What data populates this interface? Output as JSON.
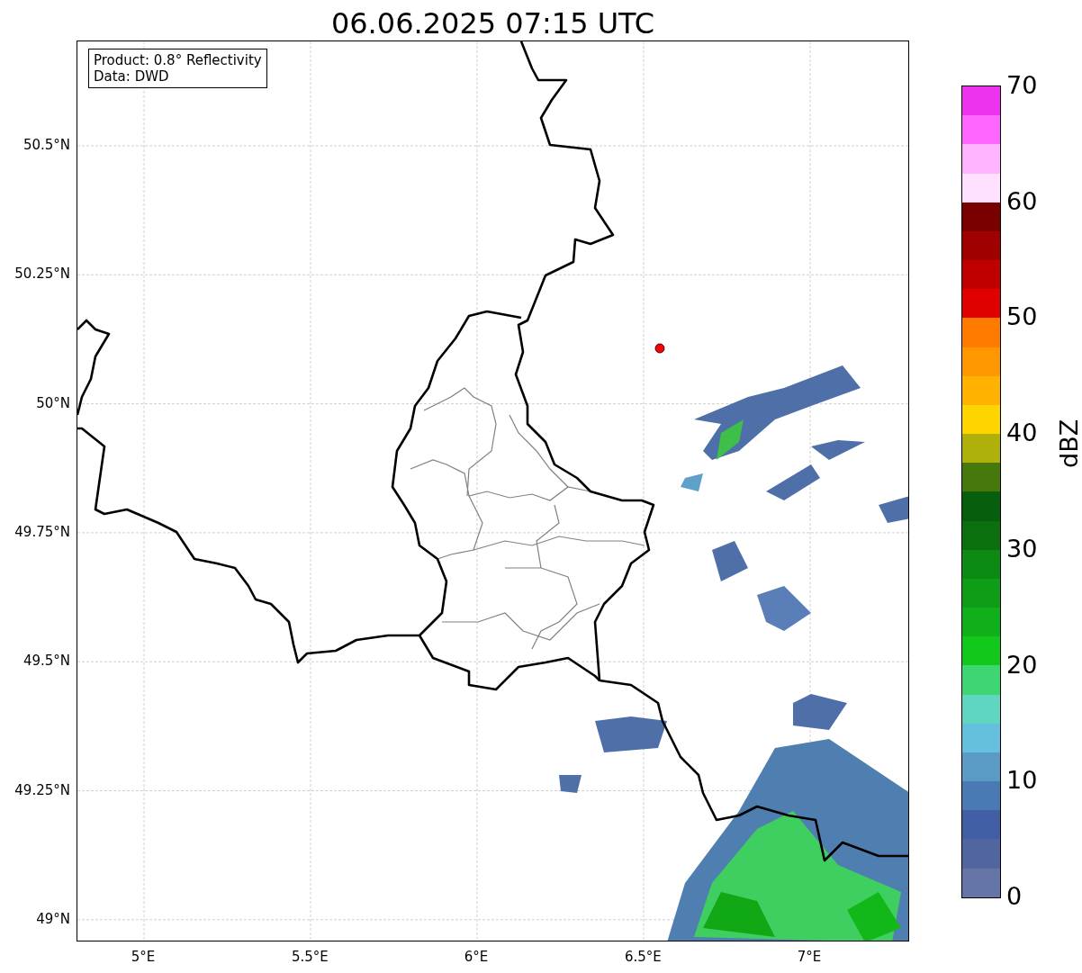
{
  "title": "06.06.2025 07:15 UTC",
  "info_box": [
    "Product: 0.8° Reflectivity",
    "Data: DWD"
  ],
  "map": {
    "y_ticks": [
      "50.5°N",
      "50.25°N",
      "50°N",
      "49.75°N",
      "49.5°N",
      "49.25°N",
      "49°N"
    ],
    "x_ticks": [
      "5°E",
      "5.5°E",
      "6°E",
      "6.5°E",
      "7°E"
    ]
  },
  "colorbar": {
    "label": "dBZ",
    "ticks": [
      "70",
      "60",
      "50",
      "40",
      "30",
      "20",
      "10",
      "0"
    ],
    "bins": [
      {
        "color": "#ee33ee"
      },
      {
        "color": "#ff66ff"
      },
      {
        "color": "#ffb3ff"
      },
      {
        "color": "#ffe0ff"
      },
      {
        "color": "#7a0000"
      },
      {
        "color": "#a00000"
      },
      {
        "color": "#c00000"
      },
      {
        "color": "#e00000"
      },
      {
        "color": "#ff7b00"
      },
      {
        "color": "#ff9800"
      },
      {
        "color": "#ffb300"
      },
      {
        "color": "#ffd500"
      },
      {
        "color": "#b0b00a"
      },
      {
        "color": "#46780c"
      },
      {
        "color": "#075f0d"
      },
      {
        "color": "#0b6f10"
      },
      {
        "color": "#0c8a12"
      },
      {
        "color": "#0f9c17"
      },
      {
        "color": "#10b01a"
      },
      {
        "color": "#12c81a"
      },
      {
        "color": "#3dd672"
      },
      {
        "color": "#5ed6c0"
      },
      {
        "color": "#64c0dc"
      },
      {
        "color": "#5a9bc6"
      },
      {
        "color": "#4a7ab3"
      },
      {
        "color": "#425fa6"
      },
      {
        "color": "#5166a0"
      },
      {
        "color": "#6675a8"
      }
    ]
  }
}
